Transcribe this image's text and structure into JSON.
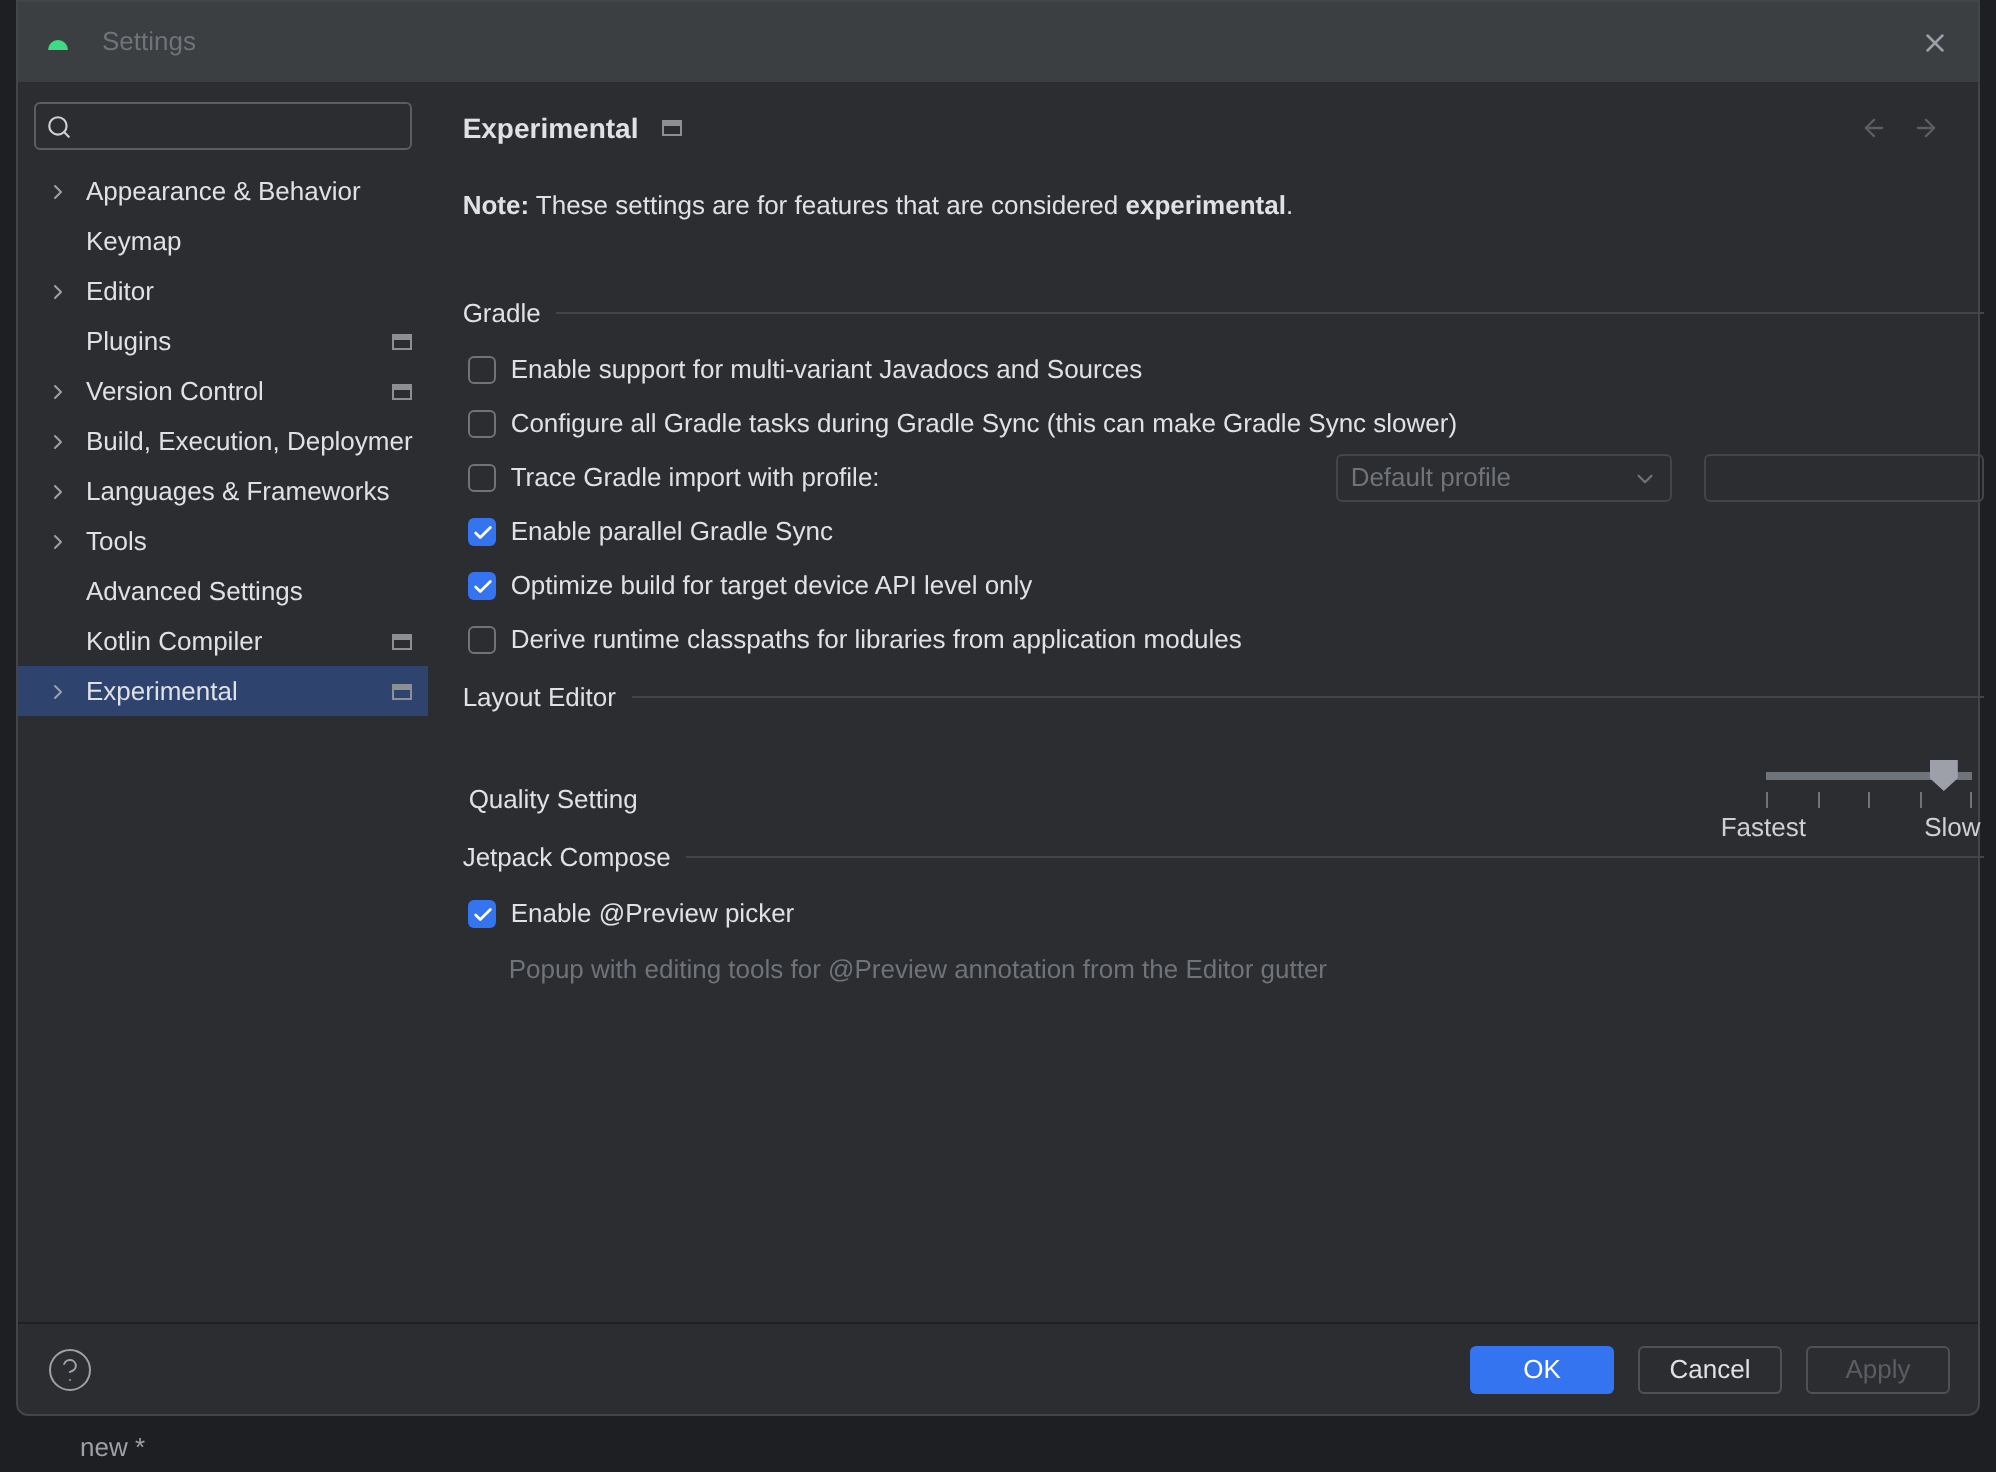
{
  "window": {
    "title": "Settings",
    "active": false
  },
  "sidebar": {
    "items": [
      {
        "label": "Appearance & Behavior",
        "expandable": true,
        "badge": false,
        "selected": false
      },
      {
        "label": "Keymap",
        "expandable": false,
        "badge": false,
        "selected": false
      },
      {
        "label": "Editor",
        "expandable": true,
        "badge": false,
        "selected": false
      },
      {
        "label": "Plugins",
        "expandable": false,
        "badge": true,
        "selected": false
      },
      {
        "label": "Version Control",
        "expandable": true,
        "badge": true,
        "selected": false
      },
      {
        "label": "Build, Execution, Deploymer",
        "expandable": true,
        "badge": false,
        "selected": false
      },
      {
        "label": "Languages & Frameworks",
        "expandable": true,
        "badge": false,
        "selected": false
      },
      {
        "label": "Tools",
        "expandable": true,
        "badge": false,
        "selected": false
      },
      {
        "label": "Advanced Settings",
        "expandable": false,
        "badge": false,
        "selected": false
      },
      {
        "label": "Kotlin Compiler",
        "expandable": false,
        "badge": true,
        "selected": false
      },
      {
        "label": "Experimental",
        "expandable": true,
        "badge": true,
        "selected": true
      }
    ]
  },
  "page": {
    "title": "Experimental",
    "badge": true,
    "back_disabled": true,
    "forward_disabled": true,
    "note": "**Note:** These settings are for features that are considered **experimental**."
  },
  "sections": [
    {
      "title": "Gradle",
      "items": [
        {
          "kind": "checkbox",
          "label": "Enable support for multi-variant Javadocs and Sources",
          "checked": false
        },
        {
          "kind": "checkbox",
          "label": "Configure all Gradle tasks during Gradle Sync (this can make Gradle Sync slower)",
          "checked": false
        },
        {
          "kind": "profile",
          "label": "Trace Gradle import with profile:",
          "checked": false,
          "dropdown": "Default profile"
        },
        {
          "kind": "checkbox",
          "label": "Enable parallel Gradle Sync",
          "checked": true
        },
        {
          "kind": "checkbox",
          "label": "Optimize build for target device API level only",
          "checked": true
        },
        {
          "kind": "checkbox",
          "label": "Derive runtime classpaths for libraries from application modules",
          "checked": false
        }
      ]
    },
    {
      "title": "Layout Editor",
      "items": [
        {
          "kind": "slider",
          "label": "Quality Setting",
          "level": 0.86,
          "min_label": "Fastest",
          "max_label": "Slow"
        }
      ]
    },
    {
      "title": "Jetpack Compose",
      "items": [
        {
          "kind": "checkbox",
          "label": "Enable @Preview picker",
          "checked": true,
          "description": "Popup with editing tools for @Preview annotation from the Editor gutter"
        }
      ]
    }
  ],
  "footer": {
    "buttons": [
      {
        "label": "OK",
        "kind": "primary",
        "disabled": false
      },
      {
        "label": "Cancel",
        "kind": "default",
        "disabled": false
      },
      {
        "label": "Apply",
        "kind": "default",
        "disabled": true
      }
    ]
  },
  "background": {
    "tab_label": "new *"
  }
}
